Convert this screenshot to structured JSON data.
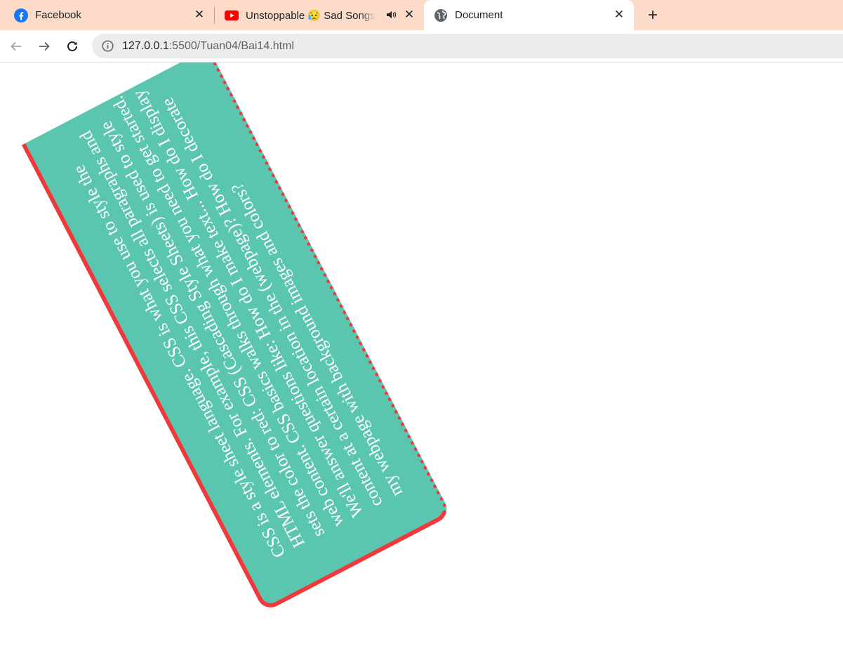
{
  "browser": {
    "tabs": [
      {
        "title": "Facebook",
        "icon": "facebook-icon",
        "close": "✕"
      },
      {
        "title": "Unstoppable 😥 Sad Songs P",
        "icon": "youtube-icon",
        "close": "✕",
        "audio_icon": "speaker-icon"
      },
      {
        "title": "Document",
        "icon": "globe-icon",
        "close": "✕",
        "active": true
      }
    ],
    "new_tab": "+",
    "address": {
      "host": "127.0.0.1",
      "path": ":5500/Tuan04/Bai14.html"
    }
  },
  "page": {
    "paragraph": "CSS is a style sheet language. CSS is what you use to style the HTML elements. For example, this CSS selects all paragraphs and sets the color to red: CSS (Cascading Style Sheets) is used to style web content. CSS basics walks through what you need to get started. We'll answer questions like: How do I make text... How do I display content at a certain location in the (webpage)? How do I decorate my webpage with background images and colors?"
  },
  "colors": {
    "card_background": "#5bc6b0",
    "card_border": "#f3373a",
    "tab_strip": "#fcdcc9"
  }
}
